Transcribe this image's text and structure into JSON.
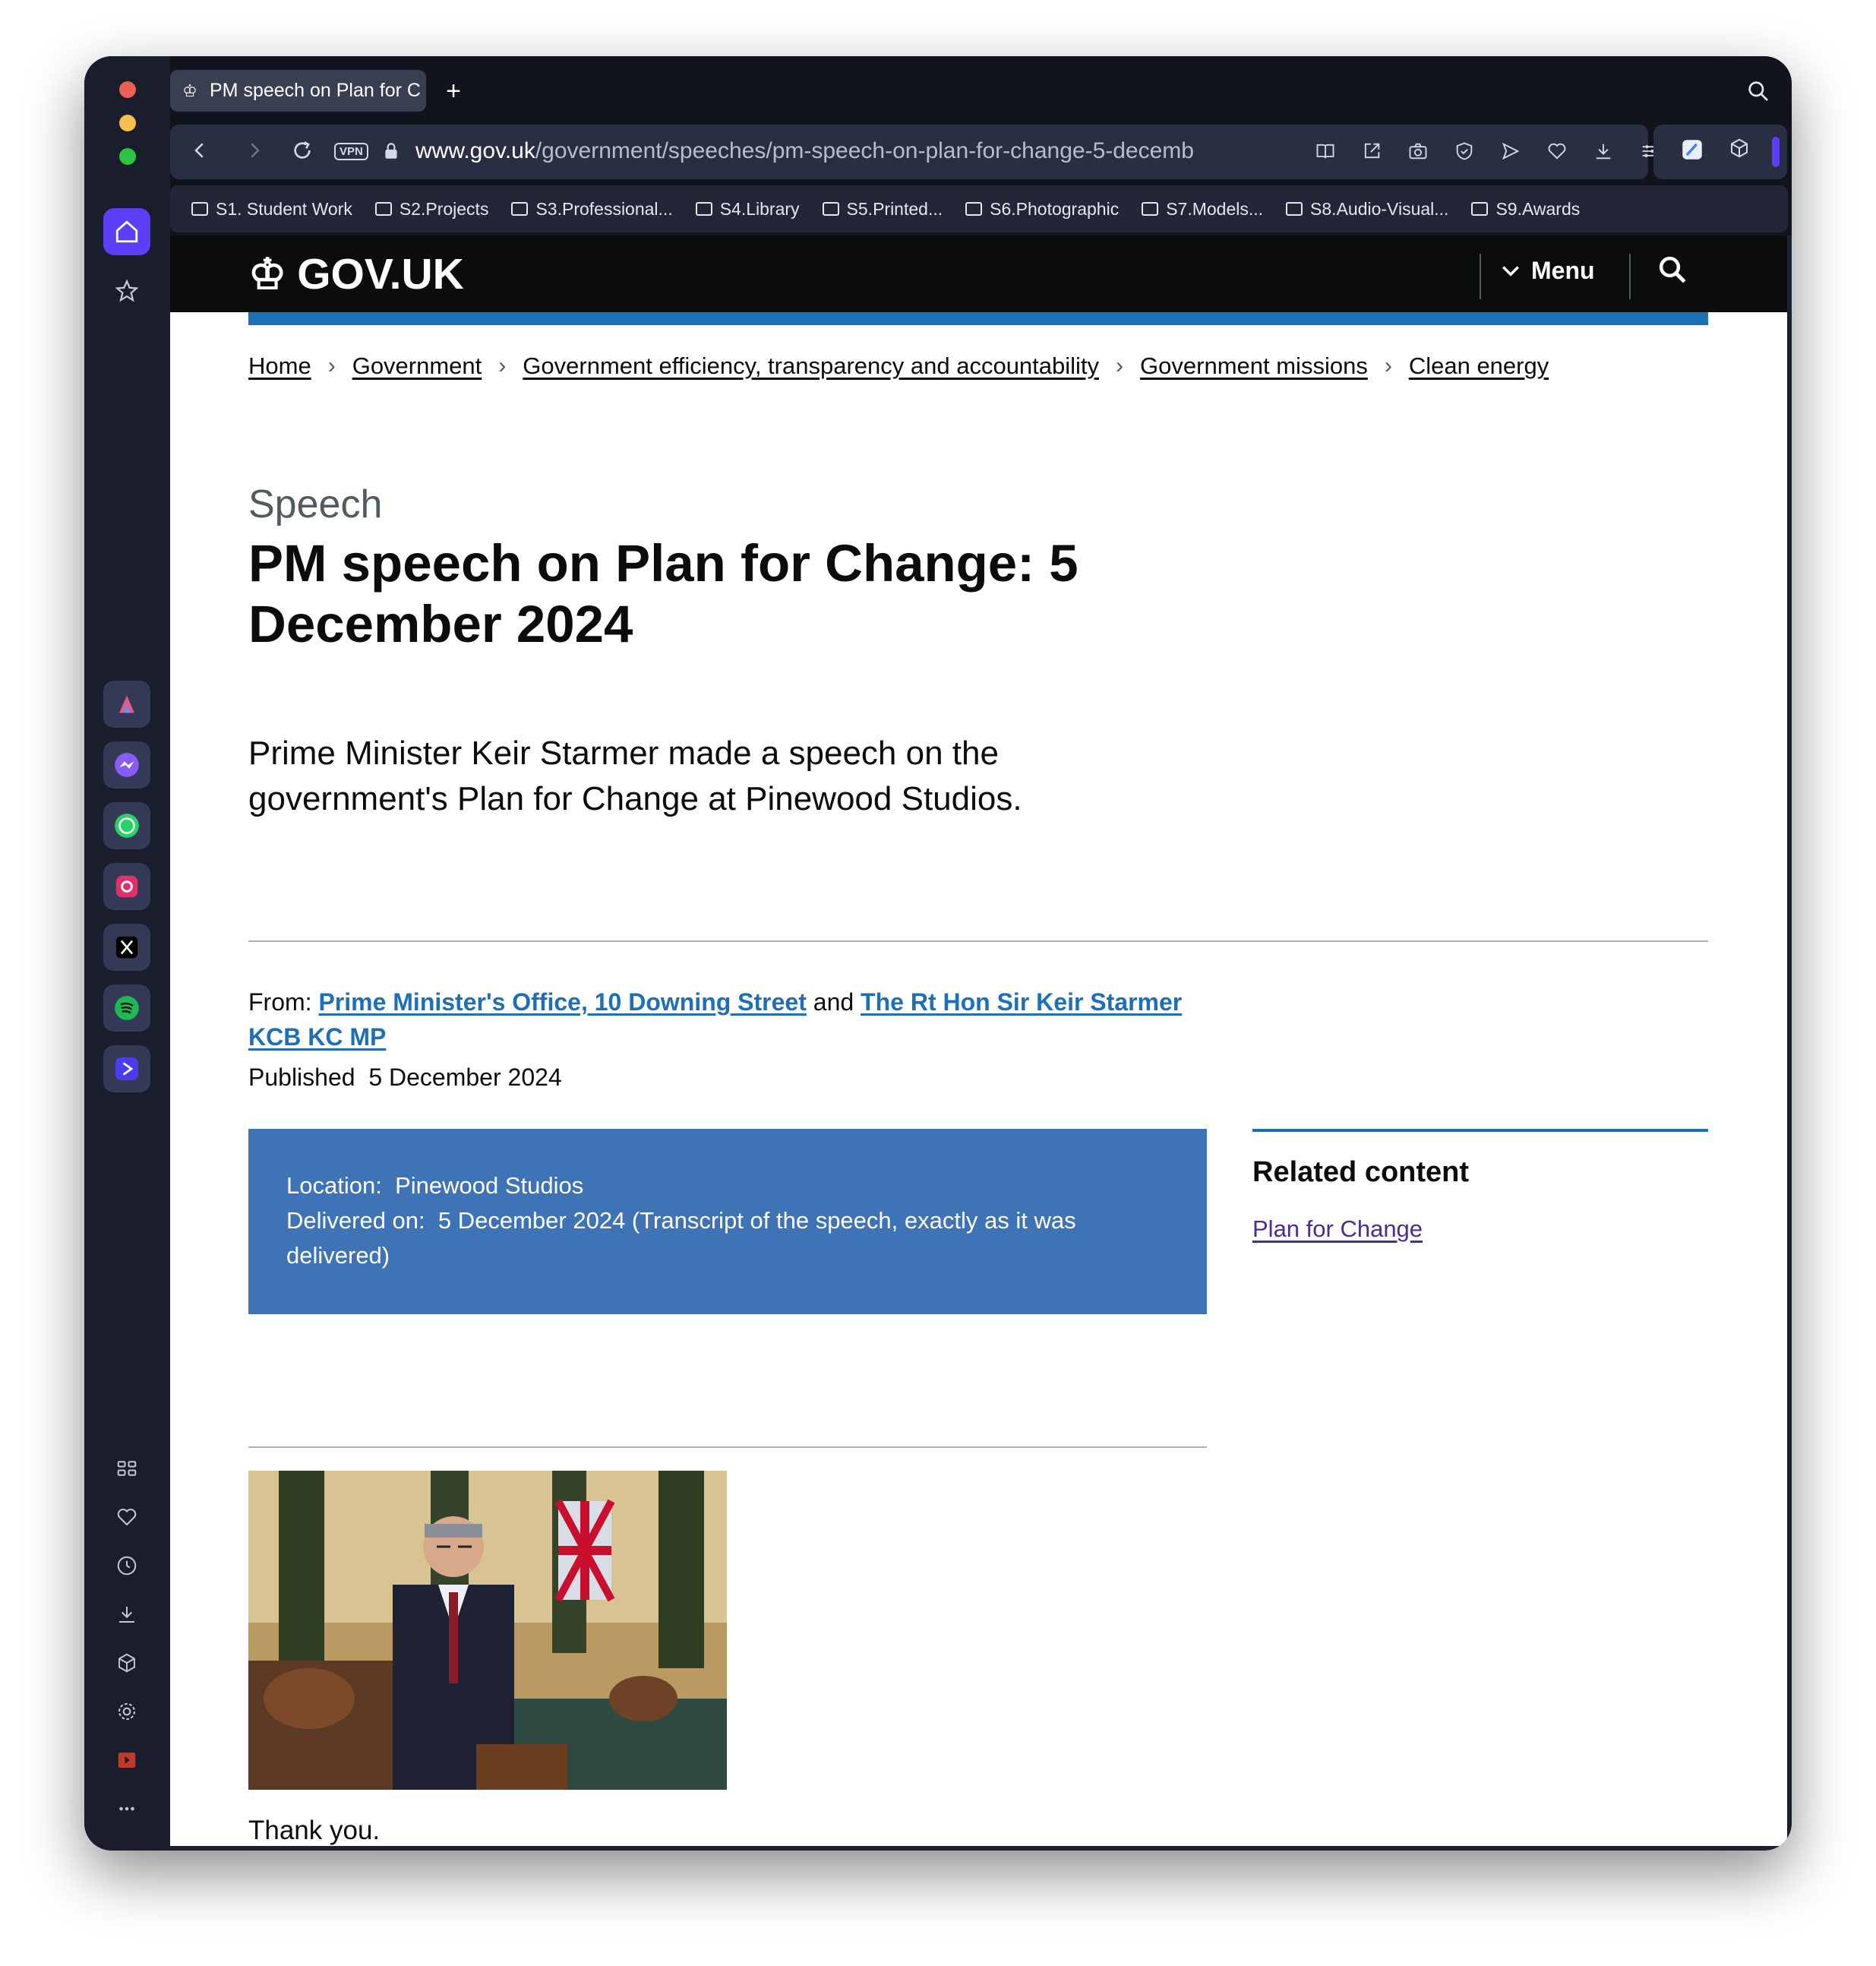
{
  "browser": {
    "tab_title": "PM speech on Plan for C",
    "url_domain": "www.gov.uk",
    "url_path": "/government/speeches/pm-speech-on-plan-for-change-5-decemb",
    "vpn_label": "VPN",
    "bookmarks": [
      "S1. Student Work",
      "S2.Projects",
      "S3.Professional...",
      "S4.Library",
      "S5.Printed...",
      "S6.Photographic",
      "S7.Models...",
      "S8.Audio-Visual...",
      "S9.Awards"
    ]
  },
  "header": {
    "logo": "GOV.UK",
    "menu_label": "Menu"
  },
  "breadcrumbs": [
    "Home",
    "Government",
    "Government efficiency, transparency and accountability",
    "Government missions",
    "Clean energy"
  ],
  "article": {
    "caption": "Speech",
    "title": "PM speech on Plan for Change: 5 December 2024",
    "lead": "Prime Minister Keir Starmer made a speech on the government's Plan for Change at Pinewood Studios.",
    "from_label": "From:",
    "from_org1": "Prime Minister's Office, 10 Downing Street",
    "from_and": "and",
    "from_org2": "The Rt Hon Sir Keir Starmer KCB KC MP",
    "published_label": "Published",
    "published_date": "5 December 2024",
    "location_label": "Location:",
    "location_value": "Pinewood Studios",
    "delivered_label": "Delivered on:",
    "delivered_value": "5 December 2024 (Transcript of the speech, exactly as it was delivered)",
    "body_first": "Thank you."
  },
  "related": {
    "title": "Related content",
    "link": "Plan for Change"
  },
  "colors": {
    "govuk_blue": "#1d70b8",
    "box_blue": "#3e73b5",
    "header_black": "#0b0c0c",
    "visited_link": "#4c2c92"
  }
}
